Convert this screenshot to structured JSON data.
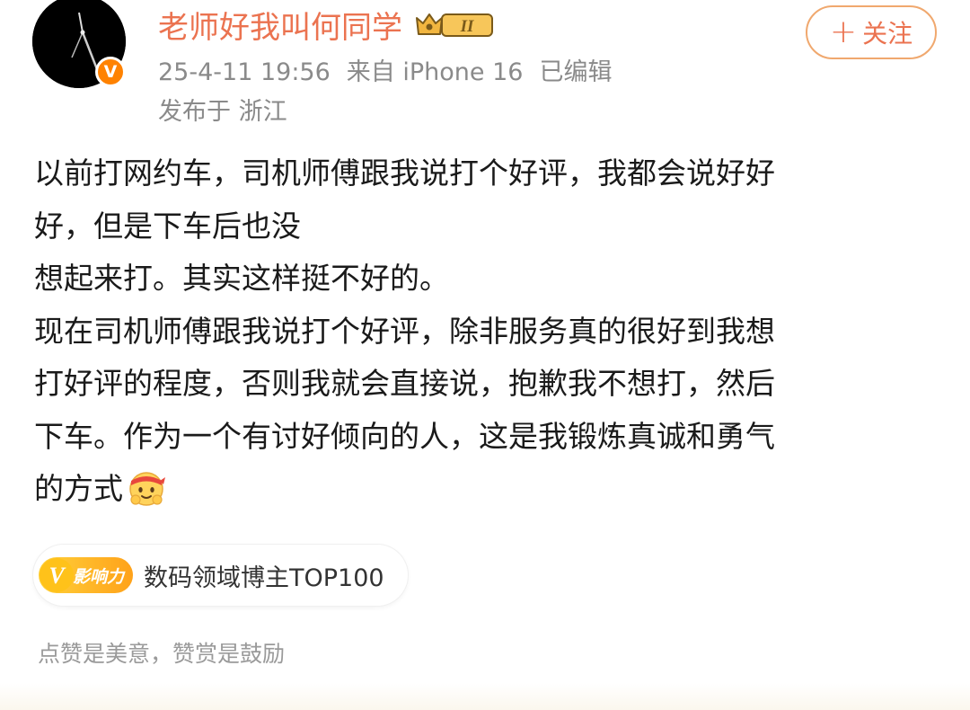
{
  "author": {
    "name": "老师好我叫何同学",
    "verified_badge": "V",
    "level_badge": "II",
    "timestamp": "25-4-11 19:56",
    "source": "来自 iPhone 16",
    "edited": "已编辑",
    "location": "发布于 浙江"
  },
  "actions": {
    "follow_plus": "+",
    "follow_label": "关注"
  },
  "post": {
    "lines": [
      "以前打网约车，司机师傅跟我说打个好评，我都会说好好",
      "好，但是下车后也没",
      "想起来打。其实这样挺不好的。",
      "现在司机师傅跟我说打个好评，除非服务真的很好到我想",
      "打好评的程度，否则我就会直接说，抱歉我不想打，然后",
      "下车。作为一个有讨好倾向的人，这是我锻炼真诚和勇气",
      "的方式"
    ],
    "emoji": "fighting-emoji"
  },
  "influence": {
    "tag_letter": "V",
    "tag_label": "影响力",
    "title": "数码领域博主TOP100"
  },
  "reward": {
    "text": "点赞是美意，赞赏是鼓励"
  },
  "colors": {
    "username": "#eb7350",
    "follow_border": "#f0a86e",
    "verified": "#ff8200",
    "meta_text": "#8a8a8a",
    "body_text": "#1a1a1a",
    "influence_gold": "#ffa21a"
  }
}
